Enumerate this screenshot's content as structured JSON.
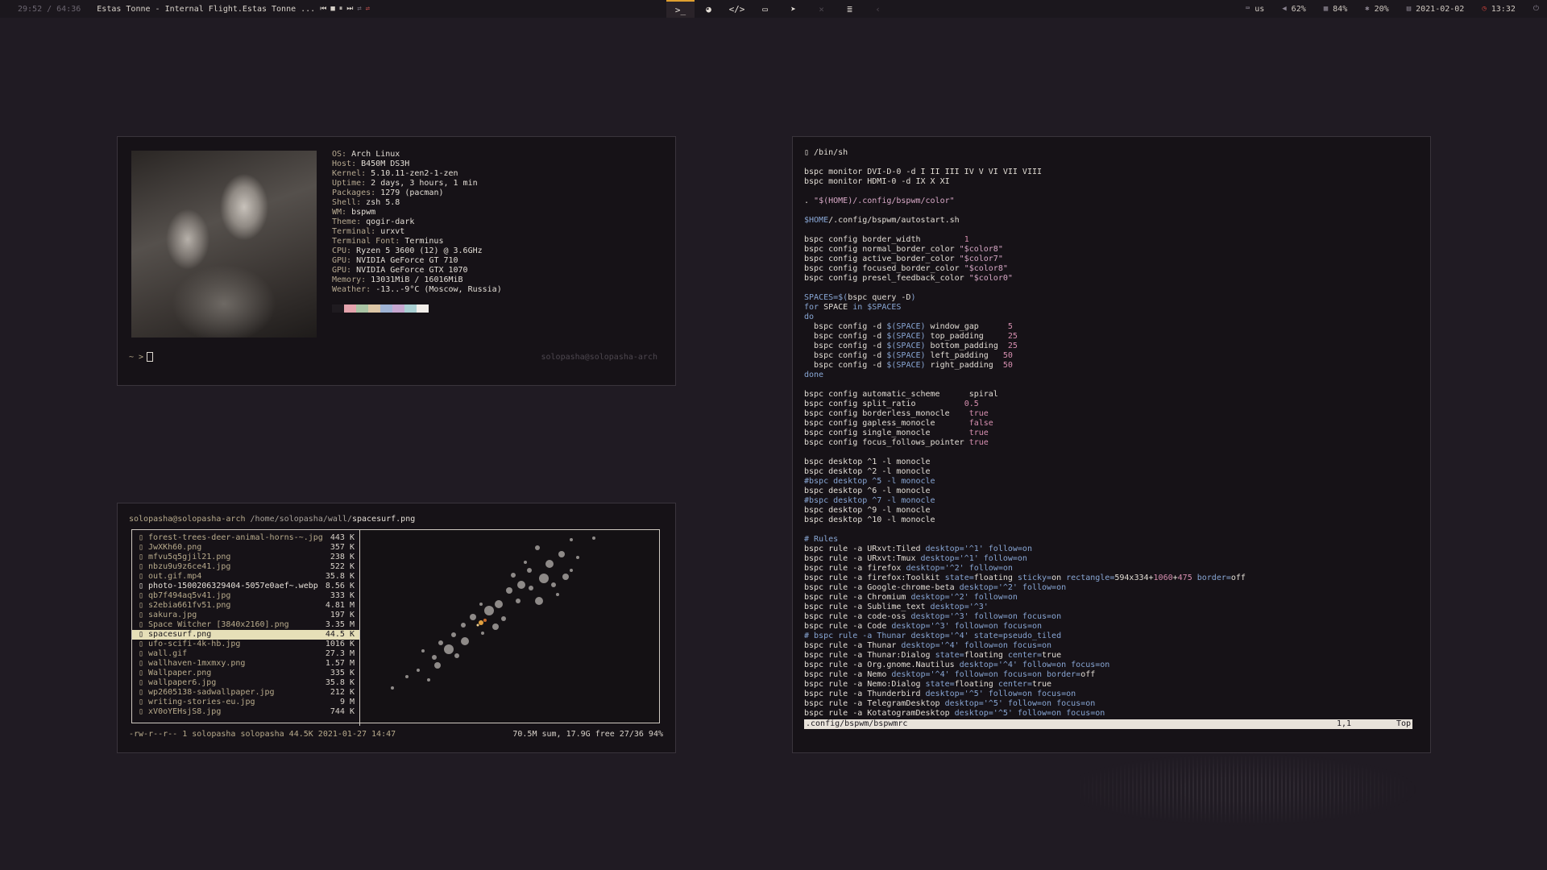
{
  "topbar": {
    "elapsed": "29:52 / 64:36",
    "track": "Estas Tonne - Internal Flight.Estas Tonne ...",
    "workspaces": [
      {
        "icon": "terminal-icon",
        "glyph": ">_",
        "active": true,
        "dim": false
      },
      {
        "icon": "browser-icon",
        "glyph": "◕",
        "active": false,
        "dim": false
      },
      {
        "icon": "code-icon",
        "glyph": "</>",
        "active": false,
        "dim": false
      },
      {
        "icon": "folder-icon",
        "glyph": "▭",
        "active": false,
        "dim": false
      },
      {
        "icon": "telegram-icon",
        "glyph": "➤",
        "active": false,
        "dim": false
      },
      {
        "icon": "empty-ws-icon",
        "glyph": "×",
        "active": false,
        "dim": true
      },
      {
        "icon": "list-icon",
        "glyph": "≣",
        "active": false,
        "dim": false
      },
      {
        "icon": "empty-ws-icon",
        "glyph": "‹",
        "active": false,
        "dim": true
      }
    ],
    "keyboard": "us",
    "volume": "62%",
    "cpu": "84%",
    "memory": "20%",
    "date": "2021-02-02",
    "clock": "13:32",
    "accent": "#e0a030"
  },
  "neofetch": {
    "rows": [
      {
        "k": "OS: ",
        "v": "Arch Linux"
      },
      {
        "k": "Host: ",
        "v": "B450M DS3H"
      },
      {
        "k": "Kernel: ",
        "v": "5.10.11-zen2-1-zen"
      },
      {
        "k": "Uptime: ",
        "v": "2 days, 3 hours, 1 min"
      },
      {
        "k": "Packages: ",
        "v": "1279 (pacman)"
      },
      {
        "k": "Shell: ",
        "v": "zsh 5.8"
      },
      {
        "k": "WM: ",
        "v": "bspwm"
      },
      {
        "k": "Theme: ",
        "v": "qogir-dark"
      },
      {
        "k": "Terminal: ",
        "v": "urxvt"
      },
      {
        "k": "Terminal Font: ",
        "v": "Terminus"
      },
      {
        "k": "CPU: ",
        "v": "Ryzen 5 3600 (12) @ 3.6GHz"
      },
      {
        "k": "GPU: ",
        "v": "NVIDIA GeForce GT 710"
      },
      {
        "k": "GPU: ",
        "v": "NVIDIA GeForce GTX 1070"
      },
      {
        "k": "Memory: ",
        "v": "13031MiB / 16016MiB"
      },
      {
        "k": "Weather: ",
        "v": "-13..-9°C (Moscow, Russia)"
      }
    ],
    "palette": [
      "#1f1b20",
      "#e4a3ad",
      "#a9c3a4",
      "#dcc6a6",
      "#9fb3d4",
      "#c6a7d0",
      "#a9cfd2",
      "#f2eeea"
    ],
    "prompt": "~ >",
    "right_prompt": "solopasha@solopasha-arch"
  },
  "ranger": {
    "host": "solopasha@solopasha-arch",
    "path": "/home/solopasha/wall/",
    "file": "spacesurf.png",
    "files": [
      {
        "name": "▯ forest-trees-deer-animal-horns-~.jpg",
        "size": "443 K",
        "white": false,
        "sel": false
      },
      {
        "name": "▯ JwXKh60.png",
        "size": "357 K",
        "white": false,
        "sel": false
      },
      {
        "name": "▯ mfvu5q5gjil21.png",
        "size": "238 K",
        "white": false,
        "sel": false
      },
      {
        "name": "▯ nbzu9u9z6ce41.jpg",
        "size": "522 K",
        "white": false,
        "sel": false
      },
      {
        "name": "▯ out.gif.mp4",
        "size": "35.8 K",
        "white": false,
        "sel": false
      },
      {
        "name": "▯ photo-1500206329404-5057e0aef~.webp",
        "size": "8.56 K",
        "white": true,
        "sel": false
      },
      {
        "name": "▯ qb7f494aq5v41.jpg",
        "size": "333 K",
        "white": false,
        "sel": false
      },
      {
        "name": "▯ s2ebia661fv51.png",
        "size": "4.81 M",
        "white": false,
        "sel": false
      },
      {
        "name": "▯ sakura.jpg",
        "size": "197 K",
        "white": false,
        "sel": false
      },
      {
        "name": "▯ Space Witcher [3840x2160].png",
        "size": "3.35 M",
        "white": false,
        "sel": false
      },
      {
        "name": "▯ spacesurf.png",
        "size": "44.5 K",
        "white": false,
        "sel": true
      },
      {
        "name": "▯ ufo-scifi-4k-hb.jpg",
        "size": "1016 K",
        "white": false,
        "sel": false
      },
      {
        "name": "▯ wall.gif",
        "size": "27.3 M",
        "white": false,
        "sel": false
      },
      {
        "name": "▯ wallhaven-1mxmxy.png",
        "size": "1.57 M",
        "white": false,
        "sel": false
      },
      {
        "name": "▯ Wallpaper.png",
        "size": "335 K",
        "white": false,
        "sel": false
      },
      {
        "name": "▯ wallpaper6.jpg",
        "size": "35.8 K",
        "white": false,
        "sel": false
      },
      {
        "name": "▯ wp2605138-sadwallpaper.jpg",
        "size": "212 K",
        "white": false,
        "sel": false
      },
      {
        "name": "▯ writing-stories-eu.jpg",
        "size": "9 M",
        "white": false,
        "sel": false
      },
      {
        "name": "▯ xV0oYEHsjS8.jpg",
        "size": "744 K",
        "white": false,
        "sel": false
      }
    ],
    "footer_left": "-rw-r--r-- 1 solopasha solopasha 44.5K 2021-01-27 14:47",
    "footer_right": "70.5M sum, 17.9G free  27/36  94%"
  },
  "vim": {
    "lines": [
      [
        [
          "c-cmd",
          "▯ /bin/sh"
        ]
      ],
      [
        [
          "c-cmd",
          ""
        ]
      ],
      [
        [
          "c-cmd",
          "bspc monitor DVI-D-0 -d I II III IV V VI VII VIII"
        ]
      ],
      [
        [
          "c-cmd",
          "bspc monitor HDMI-0 -d IX X XI"
        ]
      ],
      [
        [
          "c-cmd",
          ""
        ]
      ],
      [
        [
          "c-cmd",
          ". "
        ],
        [
          "c-str",
          "\"$(HOME)/.config/bspwm/color\""
        ]
      ],
      [
        [
          "c-cmd",
          ""
        ]
      ],
      [
        [
          "c-var",
          "$HOME"
        ],
        [
          "c-cmd",
          "/.config/bspwm/autostart.sh"
        ]
      ],
      [
        [
          "c-cmd",
          ""
        ]
      ],
      [
        [
          "c-cmd",
          "bspc config border_width         "
        ],
        [
          "c-num",
          "1"
        ]
      ],
      [
        [
          "c-cmd",
          "bspc config normal_border_color "
        ],
        [
          "c-str",
          "\"$color8\""
        ]
      ],
      [
        [
          "c-cmd",
          "bspc config active_border_color "
        ],
        [
          "c-str",
          "\"$color7\""
        ]
      ],
      [
        [
          "c-cmd",
          "bspc config focused_border_color "
        ],
        [
          "c-str",
          "\"$color8\""
        ]
      ],
      [
        [
          "c-cmd",
          "bspc config presel_feedback_color "
        ],
        [
          "c-str",
          "\"$color0\""
        ]
      ],
      [
        [
          "c-cmd",
          ""
        ]
      ],
      [
        [
          "c-var",
          "SPACES=$("
        ],
        [
          "c-cmd",
          "bspc query -D"
        ],
        [
          "c-var",
          ")"
        ]
      ],
      [
        [
          "c-kw",
          "for "
        ],
        [
          "c-cmd",
          "SPACE "
        ],
        [
          "c-kw",
          "in "
        ],
        [
          "c-var",
          "$SPACES"
        ]
      ],
      [
        [
          "c-kw",
          "do"
        ]
      ],
      [
        [
          "c-cmd",
          "  bspc config -d "
        ],
        [
          "c-var",
          "$(SPACE)"
        ],
        [
          "c-cmd",
          " window_gap      "
        ],
        [
          "c-num",
          "5"
        ]
      ],
      [
        [
          "c-cmd",
          "  bspc config -d "
        ],
        [
          "c-var",
          "$(SPACE)"
        ],
        [
          "c-cmd",
          " top_padding     "
        ],
        [
          "c-num",
          "25"
        ]
      ],
      [
        [
          "c-cmd",
          "  bspc config -d "
        ],
        [
          "c-var",
          "$(SPACE)"
        ],
        [
          "c-cmd",
          " bottom_padding  "
        ],
        [
          "c-num",
          "25"
        ]
      ],
      [
        [
          "c-cmd",
          "  bspc config -d "
        ],
        [
          "c-var",
          "$(SPACE)"
        ],
        [
          "c-cmd",
          " left_padding   "
        ],
        [
          "c-num",
          "50"
        ]
      ],
      [
        [
          "c-cmd",
          "  bspc config -d "
        ],
        [
          "c-var",
          "$(SPACE)"
        ],
        [
          "c-cmd",
          " right_padding  "
        ],
        [
          "c-num",
          "50"
        ]
      ],
      [
        [
          "c-kw",
          "done"
        ]
      ],
      [
        [
          "c-cmd",
          ""
        ]
      ],
      [
        [
          "c-cmd",
          "bspc config automatic_scheme      spiral"
        ]
      ],
      [
        [
          "c-cmd",
          "bspc config split_ratio          "
        ],
        [
          "c-num",
          "0.5"
        ]
      ],
      [
        [
          "c-cmd",
          "bspc config borderless_monocle    "
        ],
        [
          "c-num",
          "true"
        ]
      ],
      [
        [
          "c-cmd",
          "bspc config gapless_monocle       "
        ],
        [
          "c-num",
          "false"
        ]
      ],
      [
        [
          "c-cmd",
          "bspc config single_monocle        "
        ],
        [
          "c-num",
          "true"
        ]
      ],
      [
        [
          "c-cmd",
          "bspc config focus_follows_pointer "
        ],
        [
          "c-num",
          "true"
        ]
      ],
      [
        [
          "c-cmd",
          ""
        ]
      ],
      [
        [
          "c-cmd",
          "bspc desktop ^1 -l monocle"
        ]
      ],
      [
        [
          "c-cmd",
          "bspc desktop ^2 -l monocle"
        ]
      ],
      [
        [
          "c-cm",
          "#bspc desktop ^5 -l monocle"
        ]
      ],
      [
        [
          "c-cmd",
          "bspc desktop ^6 -l monocle"
        ]
      ],
      [
        [
          "c-cm",
          "#bspc desktop ^7 -l monocle"
        ]
      ],
      [
        [
          "c-cmd",
          "bspc desktop ^9 -l monocle"
        ]
      ],
      [
        [
          "c-cmd",
          "bspc desktop ^10 -l monocle"
        ]
      ],
      [
        [
          "c-cmd",
          ""
        ]
      ],
      [
        [
          "c-cm",
          "# Rules"
        ]
      ],
      [
        [
          "c-cmd",
          "bspc rule -a URxvt:Tiled "
        ],
        [
          "c-var",
          "desktop='^1' follow=on"
        ]
      ],
      [
        [
          "c-cmd",
          "bspc rule -a URxvt:Tmux "
        ],
        [
          "c-var",
          "desktop='^1' follow=on"
        ]
      ],
      [
        [
          "c-cmd",
          "bspc rule -a firefox "
        ],
        [
          "c-var",
          "desktop='^2' follow=on"
        ]
      ],
      [
        [
          "c-cmd",
          "bspc rule -a firefox:Toolkit "
        ],
        [
          "c-var",
          "state="
        ],
        [
          "c-cmd",
          "floating "
        ],
        [
          "c-var",
          "sticky="
        ],
        [
          "c-cmd",
          "on "
        ],
        [
          "c-var",
          "rectangle="
        ],
        [
          "c-cmd",
          "594x334+"
        ],
        [
          "c-num",
          "1060"
        ],
        [
          "c-cmd",
          "+"
        ],
        [
          "c-num",
          "475"
        ],
        [
          "c-var",
          " border="
        ],
        [
          "c-cmd",
          "off"
        ]
      ],
      [
        [
          "c-cmd",
          "bspc rule -a Google-chrome-beta "
        ],
        [
          "c-var",
          "desktop='^2' follow=on"
        ]
      ],
      [
        [
          "c-cmd",
          "bspc rule -a Chromium "
        ],
        [
          "c-var",
          "desktop='^2' follow=on"
        ]
      ],
      [
        [
          "c-cmd",
          "bspc rule -a Sublime_text "
        ],
        [
          "c-var",
          "desktop='^3'"
        ]
      ],
      [
        [
          "c-cmd",
          "bspc rule -a code-oss "
        ],
        [
          "c-var",
          "desktop='^3' follow=on focus=on"
        ]
      ],
      [
        [
          "c-cmd",
          "bspc rule -a Code "
        ],
        [
          "c-var",
          "desktop='^3' follow=on focus=on"
        ]
      ],
      [
        [
          "c-cm",
          "# bspc rule -a Thunar desktop='^4' state=pseudo_tiled"
        ]
      ],
      [
        [
          "c-cmd",
          "bspc rule -a Thunar "
        ],
        [
          "c-var",
          "desktop='^4' follow=on focus=on"
        ]
      ],
      [
        [
          "c-cmd",
          "bspc rule -a Thunar:Dialog "
        ],
        [
          "c-var",
          "state="
        ],
        [
          "c-cmd",
          "floating "
        ],
        [
          "c-var",
          "center="
        ],
        [
          "c-cmd",
          "true"
        ]
      ],
      [
        [
          "c-cmd",
          "bspc rule -a Org.gnome.Nautilus "
        ],
        [
          "c-var",
          "desktop='^4' follow=on focus=on"
        ]
      ],
      [
        [
          "c-cmd",
          "bspc rule -a Nemo "
        ],
        [
          "c-var",
          "desktop='^4' follow=on focus=on border="
        ],
        [
          "c-cmd",
          "off"
        ]
      ],
      [
        [
          "c-cmd",
          "bspc rule -a Nemo:Dialog "
        ],
        [
          "c-var",
          "state="
        ],
        [
          "c-cmd",
          "floating "
        ],
        [
          "c-var",
          "center="
        ],
        [
          "c-cmd",
          "true"
        ]
      ],
      [
        [
          "c-cmd",
          "bspc rule -a Thunderbird "
        ],
        [
          "c-var",
          "desktop='^5' follow=on focus=on"
        ]
      ],
      [
        [
          "c-cmd",
          "bspc rule -a TelegramDesktop "
        ],
        [
          "c-var",
          "desktop='^5' follow=on focus=on"
        ]
      ],
      [
        [
          "c-cmd",
          "bspc rule -a KotatogramDesktop "
        ],
        [
          "c-var",
          "desktop='^5' follow=on focus=on"
        ]
      ]
    ],
    "status_file": ".config/bspwm/bspwmrc",
    "status_pos": "1,1",
    "status_scroll": "Top"
  }
}
